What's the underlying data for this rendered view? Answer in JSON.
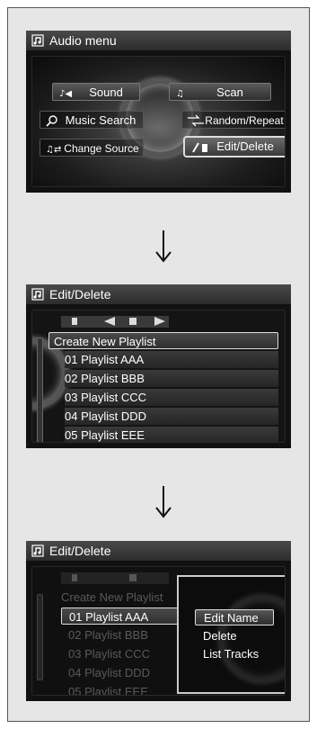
{
  "panel1": {
    "title": "Audio menu",
    "buttons": [
      {
        "label": "Sound",
        "icon": "sound-icon"
      },
      {
        "label": "Scan",
        "icon": "scan-icon"
      },
      {
        "label": "Music Search",
        "icon": "music-search-icon"
      },
      {
        "label": "Random/Repeat",
        "icon": "random-repeat-icon"
      },
      {
        "label": "Change Source",
        "icon": "change-source-icon"
      },
      {
        "label": "Edit/Delete",
        "icon": "edit-delete-icon"
      }
    ]
  },
  "panel2": {
    "title": "Edit/Delete",
    "rows": [
      "Create New Playlist",
      "01 Playlist AAA",
      "02 Playlist BBB",
      "03 Playlist CCC",
      "04 Playlist DDD",
      "05 Playlist EEE"
    ]
  },
  "panel3": {
    "title": "Edit/Delete",
    "rows": [
      "Create New Playlist",
      "01 Playlist AAA",
      "02 Playlist BBB",
      "03 Playlist CCC",
      "04 Playlist DDD",
      "05 Playlist EEE"
    ],
    "popup": [
      "Edit Name",
      "Delete",
      "List Tracks"
    ]
  }
}
